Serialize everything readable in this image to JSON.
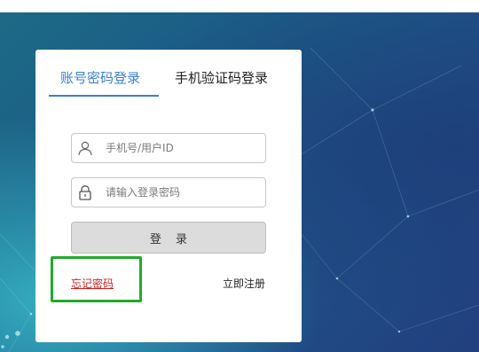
{
  "tabs": [
    {
      "label": "账号密码登录",
      "active": true
    },
    {
      "label": "手机验证码登录",
      "active": false
    }
  ],
  "form": {
    "username": {
      "value": "",
      "placeholder": "手机号/用户ID",
      "icon": "user-icon"
    },
    "password": {
      "value": "",
      "placeholder": "请输入登录密码",
      "icon": "lock-icon"
    },
    "login_label": "登 录"
  },
  "links": {
    "forgot_password": "忘记密码",
    "register": "立即注册"
  },
  "colors": {
    "accent": "#3a7fd0",
    "forgot_link": "#cc1f1f",
    "highlight_box": "#22aa2a",
    "login_button_bg": "#dcdcdc"
  }
}
